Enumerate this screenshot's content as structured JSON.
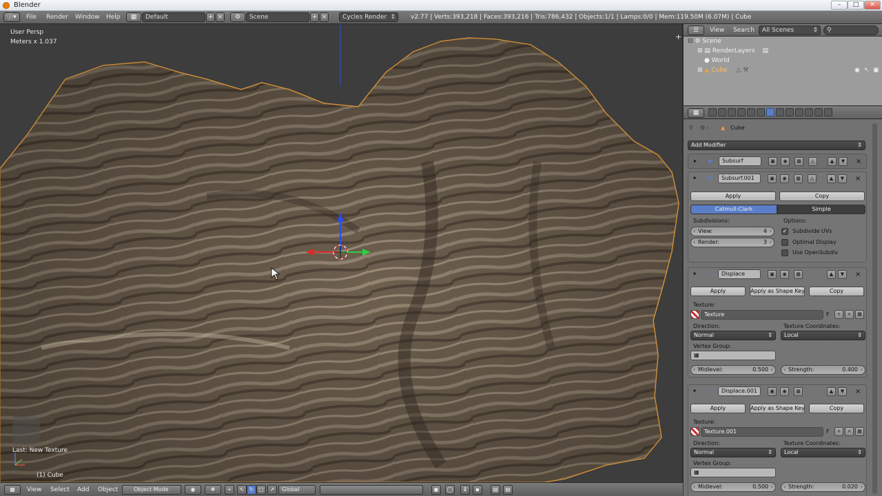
{
  "window": {
    "title": "Blender",
    "min": "–",
    "max": "□",
    "close": "✕"
  },
  "info": {
    "menus": [
      "File",
      "Render",
      "Window",
      "Help"
    ],
    "screen_layout": "Default",
    "scene": "Scene",
    "engine": "Cycles Render",
    "stats": "v2.77 | Verts:393,218 | Faces:393,216 | Tris:786,432 | Objects:1/1 | Lamps:0/0 | Mem:119.50M (6.07M) | Cube"
  },
  "viewport": {
    "view_name": "User Persp",
    "scale": "Meters x 1.037",
    "last_op": "Last: New Texture",
    "object_label": "(1) Cube"
  },
  "viewport_footer": {
    "view": "View",
    "select": "Select",
    "add": "Add",
    "object": "Object",
    "mode": "Object Mode",
    "orientation": "Global"
  },
  "outliner": {
    "view": "View",
    "search": "Search",
    "filter": "All Scenes",
    "items": {
      "scene": "Scene",
      "render_layers": "RenderLayers",
      "world": "World",
      "cube": "Cube"
    }
  },
  "properties": {
    "context": "Cube",
    "add_modifier": "Add Modifier",
    "subsurf": {
      "name": "Subsurf"
    },
    "subsurf001": {
      "name": "Subsurf.001",
      "apply": "Apply",
      "copy": "Copy",
      "catmull": "Catmull-Clark",
      "simple": "Simple",
      "subdivisions_label": "Subdivisions:",
      "view_label": "View:",
      "view_value": "4",
      "render_label": "Render:",
      "render_value": "3",
      "options_label": "Options:",
      "opt1": "Subdivide UVs",
      "opt2": "Optimal Display",
      "opt3": "Use OpenSubdiv"
    },
    "displace": {
      "name": "Displace",
      "apply": "Apply",
      "apply_shape": "Apply as Shape Key",
      "copy": "Copy",
      "texture_label": "Texture:",
      "texture": "Texture",
      "f": "F",
      "direction_label": "Direction:",
      "direction": "Normal",
      "coords_label": "Texture Coordinates:",
      "coords": "Local",
      "vgroup_label": "Vertex Group:",
      "midlevel_label": "Midlevel:",
      "midlevel": "0.500",
      "strength_label": "Strength:",
      "strength": "0.400"
    },
    "displace001": {
      "name": "Displace.001",
      "apply": "Apply",
      "apply_shape": "Apply as Shape Key",
      "copy": "Copy",
      "texture_label": "Texture:",
      "texture": "Texture.001",
      "f": "F",
      "direction_label": "Direction:",
      "direction": "Normal",
      "coords_label": "Texture Coordinates:",
      "coords": "Local",
      "vgroup_label": "Vertex Group:",
      "midlevel_label": "Midlevel:",
      "midlevel": "0.500",
      "strength_label": "Strength:",
      "strength": "0.020"
    }
  },
  "colors": {
    "accent": "#5a7ec8",
    "rock": "#7a6a55",
    "selected_outline": "#e8a040"
  }
}
